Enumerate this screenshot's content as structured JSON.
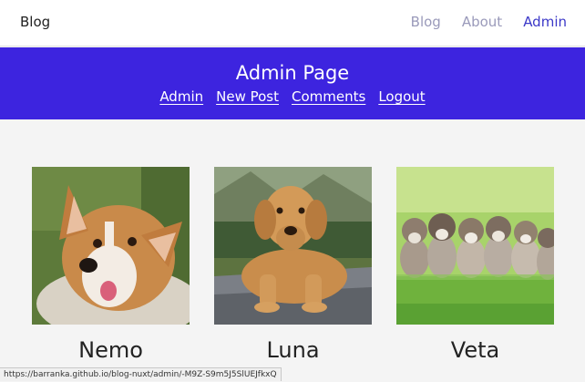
{
  "header": {
    "brand": "Blog",
    "nav": [
      {
        "label": "Blog"
      },
      {
        "label": "About"
      },
      {
        "label": "Admin"
      }
    ]
  },
  "admin": {
    "title": "Admin Page",
    "links": [
      {
        "label": "Admin"
      },
      {
        "label": "New Post"
      },
      {
        "label": "Comments"
      },
      {
        "label": "Logout"
      }
    ]
  },
  "posts": [
    {
      "name": "Nemo",
      "image": "corgi-photo"
    },
    {
      "name": "Luna",
      "image": "golden-retriever-photo"
    },
    {
      "name": "Veta",
      "image": "puppies-photo"
    }
  ],
  "status": {
    "url": "https://barranka.github.io/blog-nuxt/admin/-M9Z-S9m5J5SlUEJfkxQ"
  },
  "colors": {
    "banner": "#3d24df",
    "nav_active": "#3b38c8",
    "nav_inactive": "#9a9aba"
  }
}
